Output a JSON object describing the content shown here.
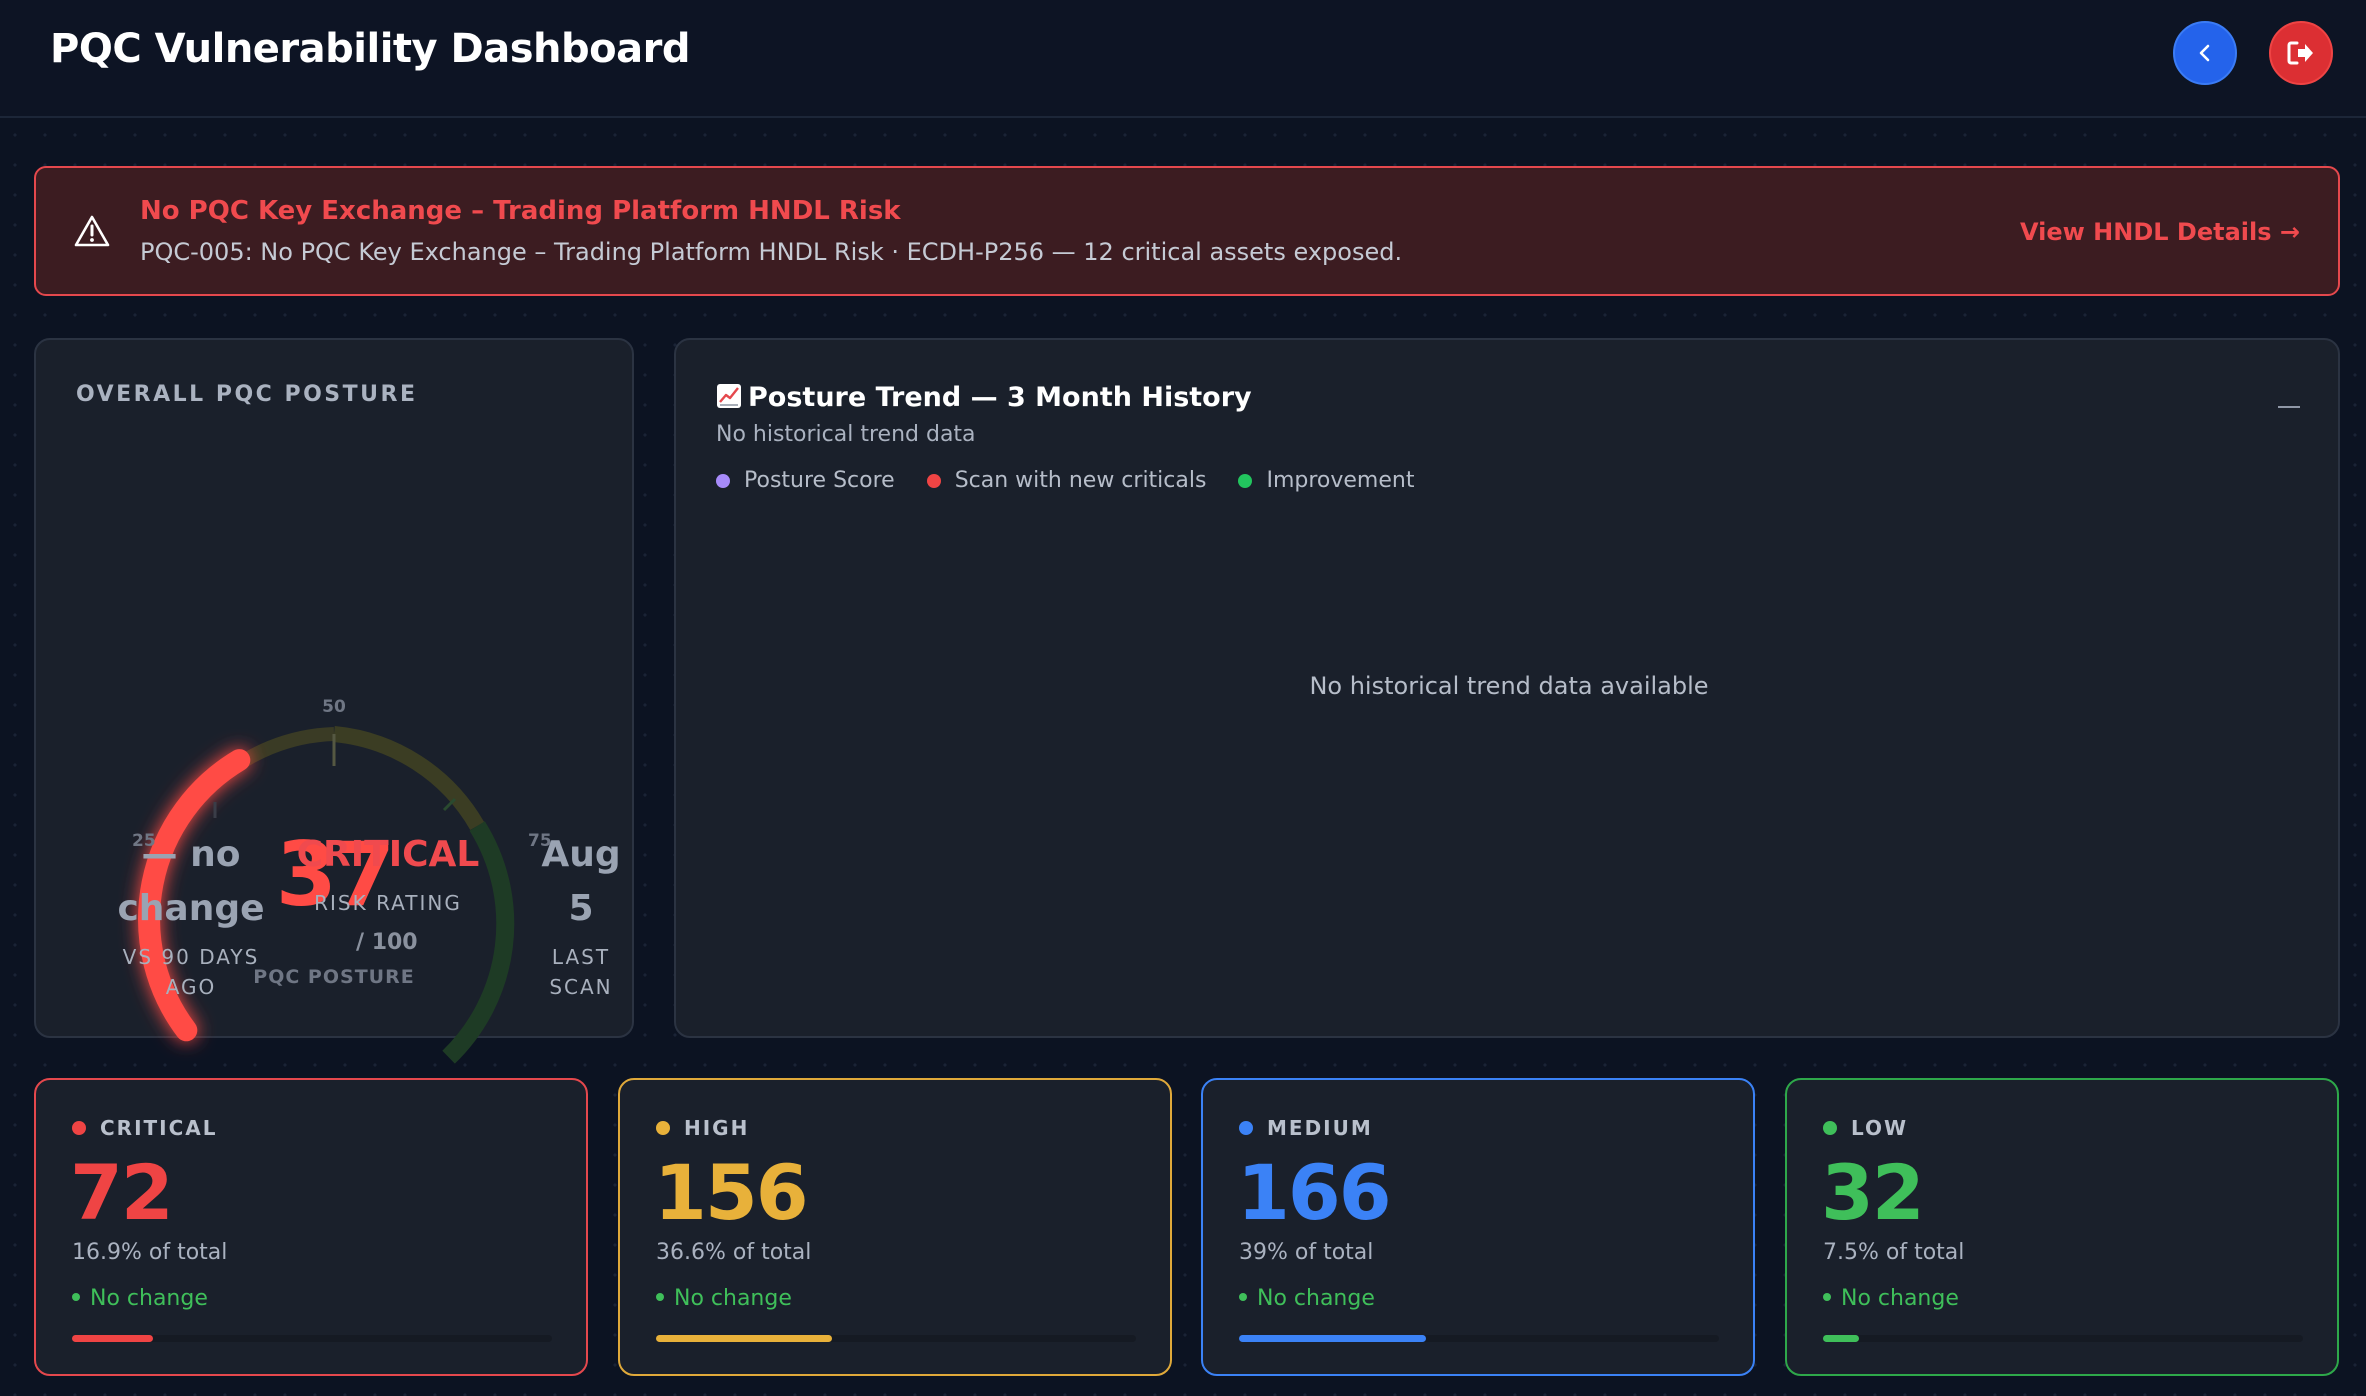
{
  "header": {
    "title": "PQC Vulnerability Dashboard",
    "back_icon": "chevron-left-icon",
    "logout_icon": "logout-icon"
  },
  "alert": {
    "icon": "warning-icon",
    "title": "No PQC Key Exchange – Trading Platform HNDL Risk",
    "description": "PQC-005: No PQC Key Exchange – Trading Platform HNDL Risk · ECDH-P256 — 12 critical assets exposed.",
    "link": "View HNDL Details →"
  },
  "posture": {
    "label": "OVERALL PQC POSTURE",
    "score": "37",
    "score_value": 37,
    "max": "/ 100",
    "gauge_caption": "PQC POSTURE",
    "ticks": [
      "25",
      "50",
      "75"
    ],
    "change_line1": "— no",
    "change_line2": "change",
    "change_label_line1": "VS 90 DAYS",
    "change_label_line2": "AGO",
    "rating": "CRITICAL",
    "rating_label": "RISK RATING",
    "scan_line1": "Aug",
    "scan_line2": "5",
    "scan_label_line1": "LAST",
    "scan_label_line2": "SCAN"
  },
  "trend": {
    "icon": "chart-increasing-icon",
    "title": "Posture Trend — 3 Month History",
    "subtitle": "No historical trend data",
    "legend": [
      {
        "label": "Posture Score",
        "color": "#a78bfa"
      },
      {
        "label": "Scan with new criticals",
        "color": "#ef4444"
      },
      {
        "label": "Improvement",
        "color": "#22c55e"
      }
    ],
    "empty": "No historical trend data available"
  },
  "severity": [
    {
      "label": "CRITICAL",
      "count": "72",
      "pct": "16.9% of total",
      "change": "No change",
      "color": "#ef4444",
      "fill": 0.169
    },
    {
      "label": "HIGH",
      "count": "156",
      "pct": "36.6% of total",
      "change": "No change",
      "color": "#e8b13a",
      "fill": 0.366
    },
    {
      "label": "MEDIUM",
      "count": "166",
      "pct": "39% of total",
      "change": "No change",
      "color": "#3b82f6",
      "fill": 0.39
    },
    {
      "label": "LOW",
      "count": "32",
      "pct": "7.5% of total",
      "change": "No change",
      "color": "#3fbf5a",
      "fill": 0.075
    }
  ]
}
